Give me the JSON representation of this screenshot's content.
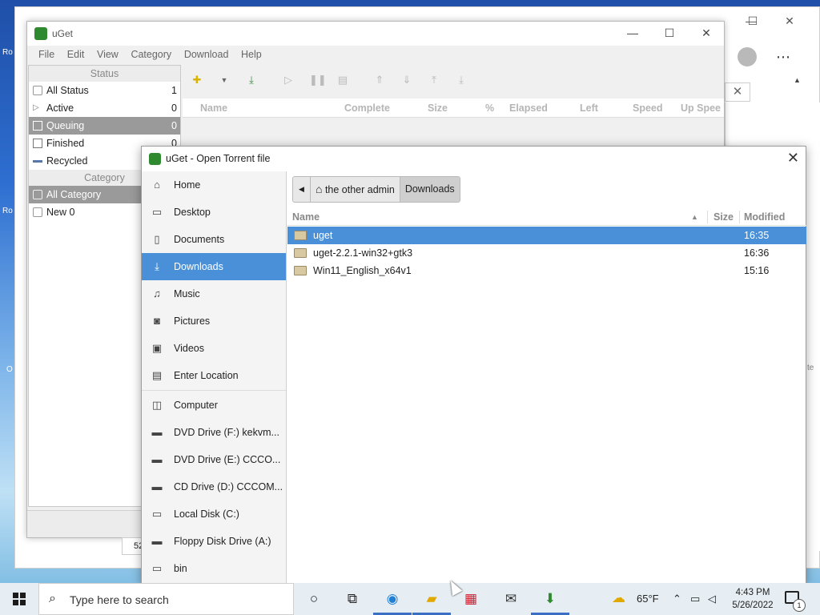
{
  "uget_window": {
    "title": "uGet",
    "menu": [
      "File",
      "Edit",
      "View",
      "Category",
      "Download",
      "Help"
    ],
    "status_header": "Status",
    "status_items": [
      {
        "label": "All Status",
        "count": "1"
      },
      {
        "label": "Active",
        "count": "0"
      },
      {
        "label": "Queuing",
        "count": "0"
      },
      {
        "label": "Finished",
        "count": "0"
      },
      {
        "label": "Recycled",
        "count": ""
      }
    ],
    "category_header": "Category",
    "category_items": [
      {
        "label": "All Category"
      },
      {
        "label": "New 0"
      }
    ],
    "table_columns": [
      "Name",
      "Complete",
      "Size",
      "%",
      "Elapsed",
      "Left",
      "Speed",
      "Up Spee"
    ],
    "statusbar_value": "52"
  },
  "dialog": {
    "title": "uGet - Open Torrent file",
    "places": [
      {
        "label": "Home",
        "icon": "home-icon"
      },
      {
        "label": "Desktop",
        "icon": "desktop-icon"
      },
      {
        "label": "Documents",
        "icon": "documents-icon"
      },
      {
        "label": "Downloads",
        "icon": "downloads-icon"
      },
      {
        "label": "Music",
        "icon": "music-icon"
      },
      {
        "label": "Pictures",
        "icon": "pictures-icon"
      },
      {
        "label": "Videos",
        "icon": "videos-icon"
      },
      {
        "label": "Enter Location",
        "icon": "location-icon"
      }
    ],
    "devices": [
      {
        "label": "Computer"
      },
      {
        "label": "DVD Drive (F:) kekvm..."
      },
      {
        "label": "DVD Drive (E:) CCCO..."
      },
      {
        "label": "CD Drive (D:) CCCOM..."
      },
      {
        "label": "Local Disk (C:)"
      },
      {
        "label": "Floppy Disk Drive (A:)"
      },
      {
        "label": "bin"
      }
    ],
    "path": [
      "the other admin",
      "Downloads"
    ],
    "columns": {
      "name": "Name",
      "size": "Size",
      "modified": "Modified"
    },
    "files": [
      {
        "name": "uget",
        "modified": "16:35"
      },
      {
        "name": "uget-2.2.1-win32+gtk3",
        "modified": "16:36"
      },
      {
        "name": "Win11_English_x64v1",
        "modified": "15:16"
      }
    ]
  },
  "taskbar": {
    "search_placeholder": "Type here to search",
    "weather": "65°F",
    "time": "4:43 PM",
    "date": "5/26/2022",
    "notification_count": "1"
  },
  "background": {
    "desktop_labels": [
      "Ro",
      "Ro",
      "O"
    ],
    "side_text": "te"
  },
  "colors": {
    "selection": "#4a90d9",
    "uget_selection": "#9a9a9a",
    "app_green": "#2f8a2f"
  }
}
